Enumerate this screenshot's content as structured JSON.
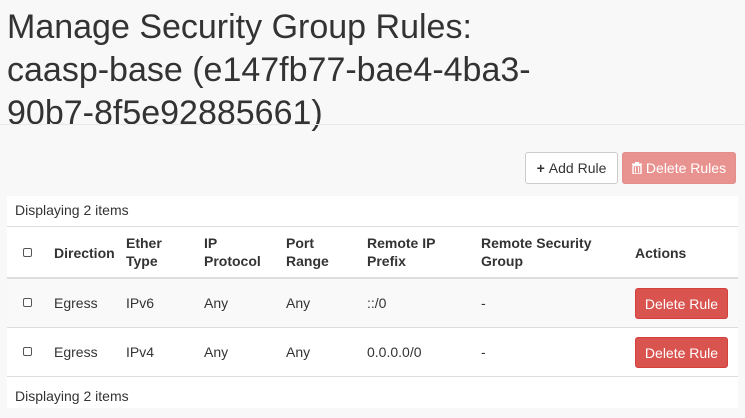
{
  "page": {
    "title": "Manage Security Group Rules: caasp-base (e147fb77-bae4-4ba3-90b7-8f5e92885661)"
  },
  "toolbar": {
    "add_rule_label": "Add Rule",
    "delete_rules_label": "Delete Rules",
    "add_icon": "plus-icon",
    "delete_icon": "trash-icon"
  },
  "table": {
    "count_top": "Displaying 2 items",
    "count_bottom": "Displaying 2 items",
    "columns": {
      "direction": "Direction",
      "ether_type_1": "Ether",
      "ether_type_2": "Type",
      "ip_protocol_1": "IP",
      "ip_protocol_2": "Protocol",
      "port_range_1": "Port",
      "port_range_2": "Range",
      "remote_ip_1": "Remote IP",
      "remote_ip_2": "Prefix",
      "remote_sg_1": "Remote Security",
      "remote_sg_2": "Group",
      "actions": "Actions"
    },
    "rows": [
      {
        "direction": "Egress",
        "ether_type": "IPv6",
        "ip_protocol": "Any",
        "port_range": "Any",
        "remote_ip_prefix": "::/0",
        "remote_security_group": "-",
        "action_label": "Delete Rule"
      },
      {
        "direction": "Egress",
        "ether_type": "IPv4",
        "ip_protocol": "Any",
        "port_range": "Any",
        "remote_ip_prefix": "0.0.0.0/0",
        "remote_security_group": "-",
        "action_label": "Delete Rule"
      }
    ]
  },
  "colors": {
    "danger": "#d9534f",
    "danger_disabled": "#e99390",
    "background": "#f8f8f9"
  }
}
